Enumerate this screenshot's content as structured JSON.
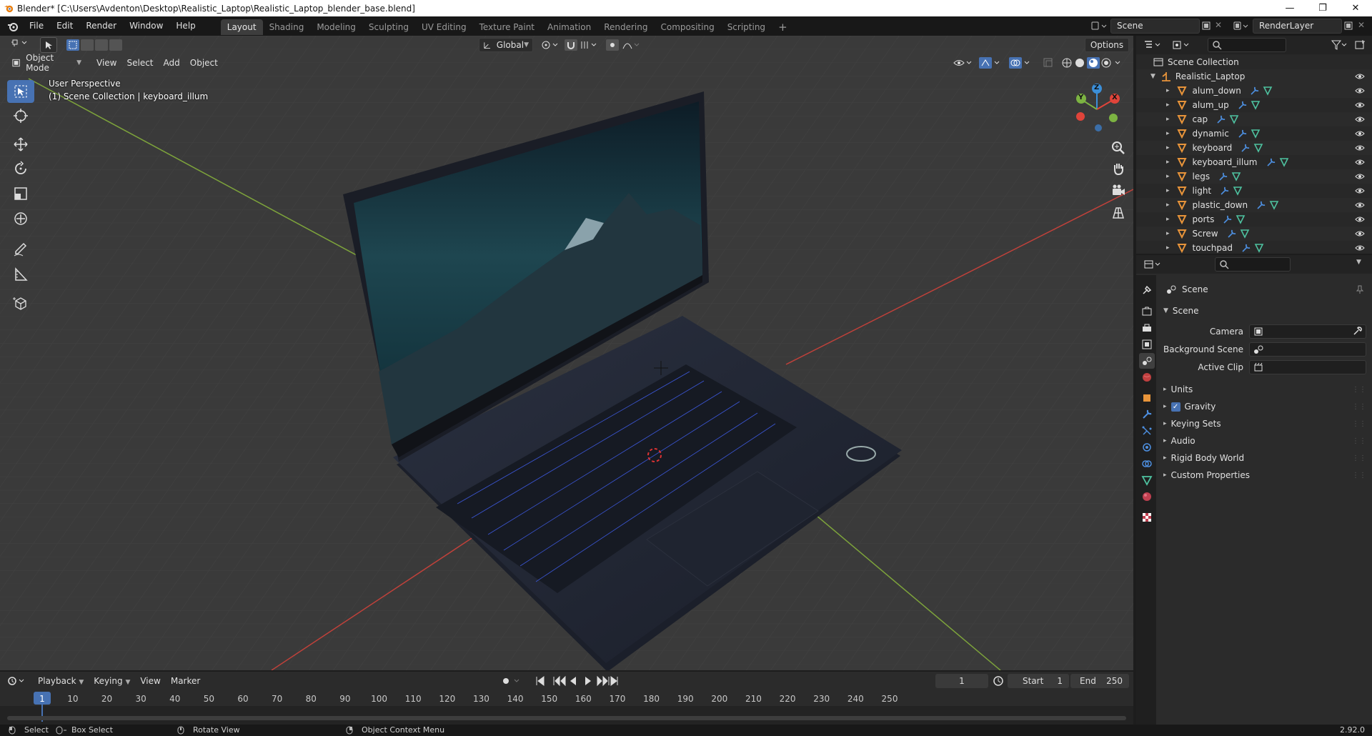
{
  "window": {
    "title": "Blender* [C:\\Users\\Avdenton\\Desktop\\Realistic_Laptop\\Realistic_Laptop_blender_base.blend]",
    "minimize": "—",
    "maximize": "❐",
    "close": "✕"
  },
  "menu": {
    "file": "File",
    "edit": "Edit",
    "render": "Render",
    "window": "Window",
    "help": "Help"
  },
  "workspaces": [
    "Layout",
    "Shading",
    "Modeling",
    "Sculpting",
    "UV Editing",
    "Texture Paint",
    "Animation",
    "Rendering",
    "Compositing",
    "Scripting"
  ],
  "add_workspace": "+",
  "scene_name": "Scene",
  "view_layer": "RenderLayer",
  "viewport": {
    "mode": "Object Mode",
    "menu_view": "View",
    "menu_select": "Select",
    "menu_add": "Add",
    "menu_object": "Object",
    "orientation": "Global",
    "options": "Options",
    "overlay_line1": "User Perspective",
    "overlay_line2": "(1) Scene Collection | keyboard_illum",
    "gizmo_x": "X",
    "gizmo_y": "Y",
    "gizmo_z": "Z"
  },
  "outliner": {
    "collection": "Scene Collection",
    "root": "Realistic_Laptop",
    "objects": [
      "alum_down",
      "alum_up",
      "cap",
      "dynamic",
      "keyboard",
      "keyboard_illum",
      "legs",
      "light",
      "plastic_down",
      "ports",
      "Screw",
      "touchpad"
    ]
  },
  "properties": {
    "context": "Scene",
    "panel_scene": "Scene",
    "camera_label": "Camera",
    "background_scene_label": "Background Scene",
    "active_clip_label": "Active Clip",
    "panels": [
      "Units",
      "Gravity",
      "Keying Sets",
      "Audio",
      "Rigid Body World",
      "Custom Properties"
    ],
    "gravity_checked": true
  },
  "timeline": {
    "playback": "Playback",
    "keying": "Keying",
    "view": "View",
    "marker": "Marker",
    "current_frame": "1",
    "start_label": "Start",
    "start": "1",
    "end_label": "End",
    "end": "250",
    "ruler": [
      "1",
      "10",
      "20",
      "30",
      "40",
      "50",
      "60",
      "70",
      "80",
      "90",
      "100",
      "110",
      "120",
      "130",
      "140",
      "150",
      "160",
      "170",
      "180",
      "190",
      "200",
      "210",
      "220",
      "230",
      "240",
      "250"
    ]
  },
  "status": {
    "select": "Select",
    "box_select": "Box Select",
    "rotate_view": "Rotate View",
    "context_menu": "Object Context Menu",
    "version": "2.92.0"
  },
  "colors": {
    "accent": "#4772b3",
    "object_orange": "#e8943a",
    "axis_x": "#e0443a",
    "axis_y": "#7cb342",
    "axis_z": "#3b8fd9"
  }
}
